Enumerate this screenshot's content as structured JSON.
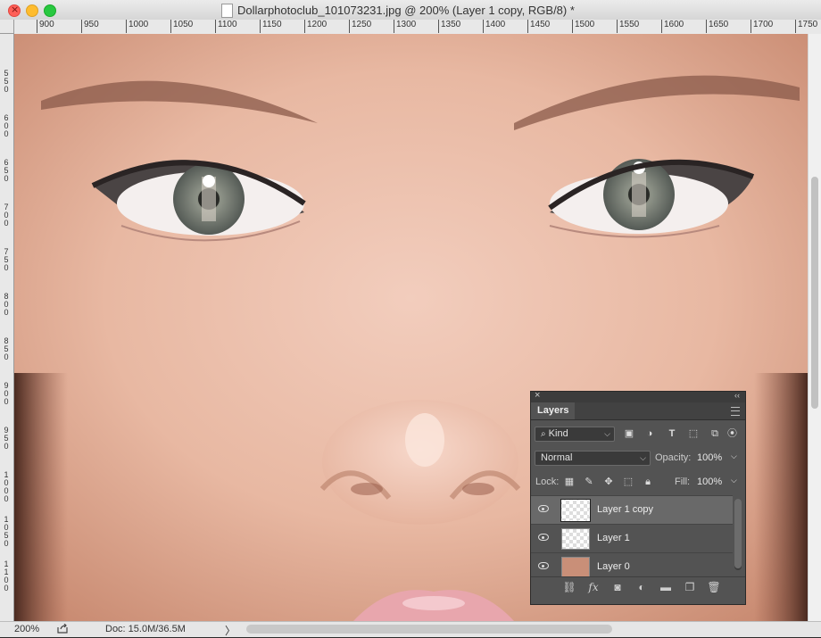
{
  "window": {
    "title": "Dollarphotoclub_101073231.jpg @ 200% (Layer 1 copy, RGB/8) *"
  },
  "ruler": {
    "top_ticks": [
      "900",
      "950",
      "1000",
      "1050",
      "1100",
      "1150",
      "1200",
      "1250",
      "1300",
      "1350",
      "1400",
      "1450",
      "1500",
      "1550",
      "1600",
      "1650",
      "1700",
      "1750"
    ],
    "left_ticks": [
      "5\n5\n0",
      "6\n0\n0",
      "6\n5\n0",
      "7\n0\n0",
      "7\n5\n0",
      "8\n0\n0",
      "8\n5\n0",
      "9\n0\n0",
      "9\n5\n0",
      "1\n0\n0\n0",
      "1\n0\n5\n0",
      "1\n1\n0\n0"
    ]
  },
  "status": {
    "zoom": "200%",
    "doc": "Doc: 15.0M/36.5M",
    "chevron": "〉"
  },
  "layers_panel": {
    "tab": "Layers",
    "filter_kind": "Kind",
    "blend_mode": "Normal",
    "opacity_label": "Opacity:",
    "opacity_value": "100%",
    "lock_label": "Lock:",
    "fill_label": "Fill:",
    "fill_value": "100%",
    "layers": [
      {
        "name": "Layer 1 copy",
        "selected": true
      },
      {
        "name": "Layer 1",
        "selected": false
      },
      {
        "name": "Layer 0",
        "selected": false
      }
    ],
    "bottom_fx": "fx"
  },
  "colors": {
    "skin": "#e7b9a4",
    "panel_bg": "#535353",
    "selected_layer": "#696969"
  }
}
